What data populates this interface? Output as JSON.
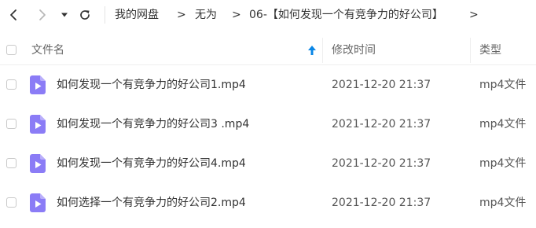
{
  "breadcrumb": [
    {
      "label": "我的网盘"
    },
    {
      "label": "无为"
    },
    {
      "label": "06-【如何发现一个有竞争力的好公司】"
    }
  ],
  "breadcrumb_separator": ">",
  "table": {
    "columns": {
      "name": "文件名",
      "modified": "修改时间",
      "type": "类型"
    },
    "rows": [
      {
        "name": "如何发现一个有竞争力的好公司1.mp4",
        "modified": "2021-12-20 21:37",
        "type": "mp4文件"
      },
      {
        "name": "如何发现一个有竞争力的好公司3 .mp4",
        "modified": "2021-12-20 21:37",
        "type": "mp4文件"
      },
      {
        "name": "如何发现一个有竞争力的好公司4.mp4",
        "modified": "2021-12-20 21:37",
        "type": "mp4文件"
      },
      {
        "name": "如何选择一个有竞争力的好公司2.mp4",
        "modified": "2021-12-20 21:37",
        "type": "mp4文件"
      }
    ]
  },
  "colors": {
    "accent": "#0a86e6",
    "video_icon": "#8b7cf6",
    "text": "#333333"
  },
  "icons": {
    "back": "chevron-left-icon",
    "forward": "chevron-right-icon",
    "history": "caret-down-icon",
    "refresh": "refresh-icon",
    "sort": "arrow-up-icon",
    "file": "video-file-icon"
  }
}
